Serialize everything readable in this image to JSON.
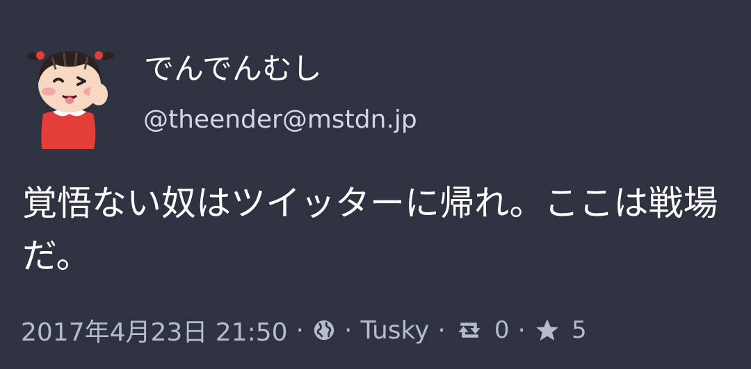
{
  "status": {
    "display_name": "でんでんむし",
    "account": "@theender@mstdn.jp",
    "content": "覚悟ない奴はツイッターに帰れ。ここは戦場だ。",
    "timestamp": "2017年4月23日 21:50",
    "separator": "·",
    "visibility_icon": "globe-icon",
    "application": "Tusky",
    "reblog_icon": "reblog-icon",
    "reblog_count": "0",
    "favourite_icon": "star-icon",
    "favourite_count": "5"
  },
  "colors": {
    "background": "#2f3241",
    "text_primary": "#ffffff",
    "text_secondary": "#b7bccd"
  }
}
